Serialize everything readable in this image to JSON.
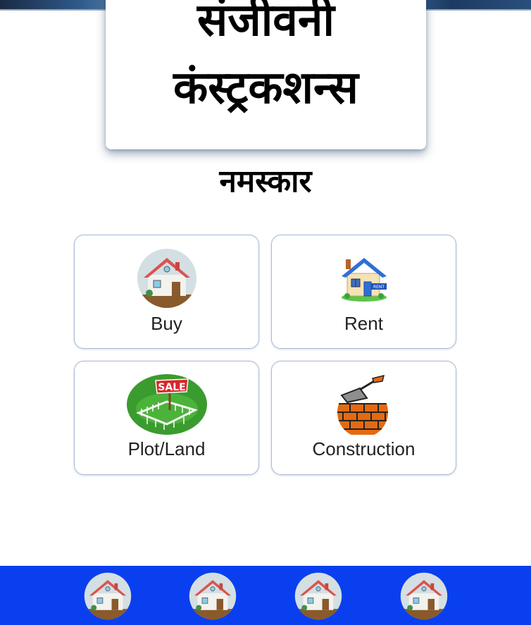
{
  "header": {
    "title_line_1": "संजीवनी",
    "title_line_2": "कंस्ट्रकशन्स"
  },
  "greeting": "नमस्कार",
  "options": [
    {
      "label": "Buy",
      "icon": "house-circle-icon"
    },
    {
      "label": "Rent",
      "icon": "rent-house-icon"
    },
    {
      "label": "Plot/Land",
      "icon": "sale-plot-icon"
    },
    {
      "label": "Construction",
      "icon": "brick-trowel-icon"
    }
  ],
  "bottom_nav": {
    "background": "#0a3ff0",
    "items": [
      {
        "icon": "house-circle-icon"
      },
      {
        "icon": "house-circle-icon"
      },
      {
        "icon": "house-circle-icon"
      },
      {
        "icon": "house-circle-icon"
      }
    ]
  },
  "colors": {
    "card_border": "#a8bad6",
    "nav_background": "#0a3ff0"
  }
}
